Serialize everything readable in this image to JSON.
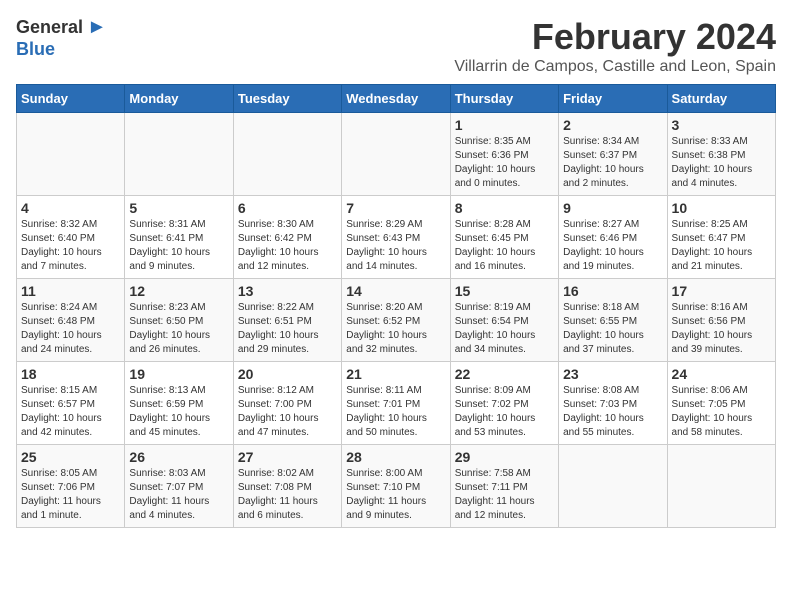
{
  "logo": {
    "general": "General",
    "blue": "Blue"
  },
  "header": {
    "month": "February 2024",
    "location": "Villarrin de Campos, Castille and Leon, Spain"
  },
  "weekdays": [
    "Sunday",
    "Monday",
    "Tuesday",
    "Wednesday",
    "Thursday",
    "Friday",
    "Saturday"
  ],
  "weeks": [
    [
      {
        "day": "",
        "info": ""
      },
      {
        "day": "",
        "info": ""
      },
      {
        "day": "",
        "info": ""
      },
      {
        "day": "",
        "info": ""
      },
      {
        "day": "1",
        "info": "Sunrise: 8:35 AM\nSunset: 6:36 PM\nDaylight: 10 hours\nand 0 minutes."
      },
      {
        "day": "2",
        "info": "Sunrise: 8:34 AM\nSunset: 6:37 PM\nDaylight: 10 hours\nand 2 minutes."
      },
      {
        "day": "3",
        "info": "Sunrise: 8:33 AM\nSunset: 6:38 PM\nDaylight: 10 hours\nand 4 minutes."
      }
    ],
    [
      {
        "day": "4",
        "info": "Sunrise: 8:32 AM\nSunset: 6:40 PM\nDaylight: 10 hours\nand 7 minutes."
      },
      {
        "day": "5",
        "info": "Sunrise: 8:31 AM\nSunset: 6:41 PM\nDaylight: 10 hours\nand 9 minutes."
      },
      {
        "day": "6",
        "info": "Sunrise: 8:30 AM\nSunset: 6:42 PM\nDaylight: 10 hours\nand 12 minutes."
      },
      {
        "day": "7",
        "info": "Sunrise: 8:29 AM\nSunset: 6:43 PM\nDaylight: 10 hours\nand 14 minutes."
      },
      {
        "day": "8",
        "info": "Sunrise: 8:28 AM\nSunset: 6:45 PM\nDaylight: 10 hours\nand 16 minutes."
      },
      {
        "day": "9",
        "info": "Sunrise: 8:27 AM\nSunset: 6:46 PM\nDaylight: 10 hours\nand 19 minutes."
      },
      {
        "day": "10",
        "info": "Sunrise: 8:25 AM\nSunset: 6:47 PM\nDaylight: 10 hours\nand 21 minutes."
      }
    ],
    [
      {
        "day": "11",
        "info": "Sunrise: 8:24 AM\nSunset: 6:48 PM\nDaylight: 10 hours\nand 24 minutes."
      },
      {
        "day": "12",
        "info": "Sunrise: 8:23 AM\nSunset: 6:50 PM\nDaylight: 10 hours\nand 26 minutes."
      },
      {
        "day": "13",
        "info": "Sunrise: 8:22 AM\nSunset: 6:51 PM\nDaylight: 10 hours\nand 29 minutes."
      },
      {
        "day": "14",
        "info": "Sunrise: 8:20 AM\nSunset: 6:52 PM\nDaylight: 10 hours\nand 32 minutes."
      },
      {
        "day": "15",
        "info": "Sunrise: 8:19 AM\nSunset: 6:54 PM\nDaylight: 10 hours\nand 34 minutes."
      },
      {
        "day": "16",
        "info": "Sunrise: 8:18 AM\nSunset: 6:55 PM\nDaylight: 10 hours\nand 37 minutes."
      },
      {
        "day": "17",
        "info": "Sunrise: 8:16 AM\nSunset: 6:56 PM\nDaylight: 10 hours\nand 39 minutes."
      }
    ],
    [
      {
        "day": "18",
        "info": "Sunrise: 8:15 AM\nSunset: 6:57 PM\nDaylight: 10 hours\nand 42 minutes."
      },
      {
        "day": "19",
        "info": "Sunrise: 8:13 AM\nSunset: 6:59 PM\nDaylight: 10 hours\nand 45 minutes."
      },
      {
        "day": "20",
        "info": "Sunrise: 8:12 AM\nSunset: 7:00 PM\nDaylight: 10 hours\nand 47 minutes."
      },
      {
        "day": "21",
        "info": "Sunrise: 8:11 AM\nSunset: 7:01 PM\nDaylight: 10 hours\nand 50 minutes."
      },
      {
        "day": "22",
        "info": "Sunrise: 8:09 AM\nSunset: 7:02 PM\nDaylight: 10 hours\nand 53 minutes."
      },
      {
        "day": "23",
        "info": "Sunrise: 8:08 AM\nSunset: 7:03 PM\nDaylight: 10 hours\nand 55 minutes."
      },
      {
        "day": "24",
        "info": "Sunrise: 8:06 AM\nSunset: 7:05 PM\nDaylight: 10 hours\nand 58 minutes."
      }
    ],
    [
      {
        "day": "25",
        "info": "Sunrise: 8:05 AM\nSunset: 7:06 PM\nDaylight: 11 hours\nand 1 minute."
      },
      {
        "day": "26",
        "info": "Sunrise: 8:03 AM\nSunset: 7:07 PM\nDaylight: 11 hours\nand 4 minutes."
      },
      {
        "day": "27",
        "info": "Sunrise: 8:02 AM\nSunset: 7:08 PM\nDaylight: 11 hours\nand 6 minutes."
      },
      {
        "day": "28",
        "info": "Sunrise: 8:00 AM\nSunset: 7:10 PM\nDaylight: 11 hours\nand 9 minutes."
      },
      {
        "day": "29",
        "info": "Sunrise: 7:58 AM\nSunset: 7:11 PM\nDaylight: 11 hours\nand 12 minutes."
      },
      {
        "day": "",
        "info": ""
      },
      {
        "day": "",
        "info": ""
      }
    ]
  ]
}
